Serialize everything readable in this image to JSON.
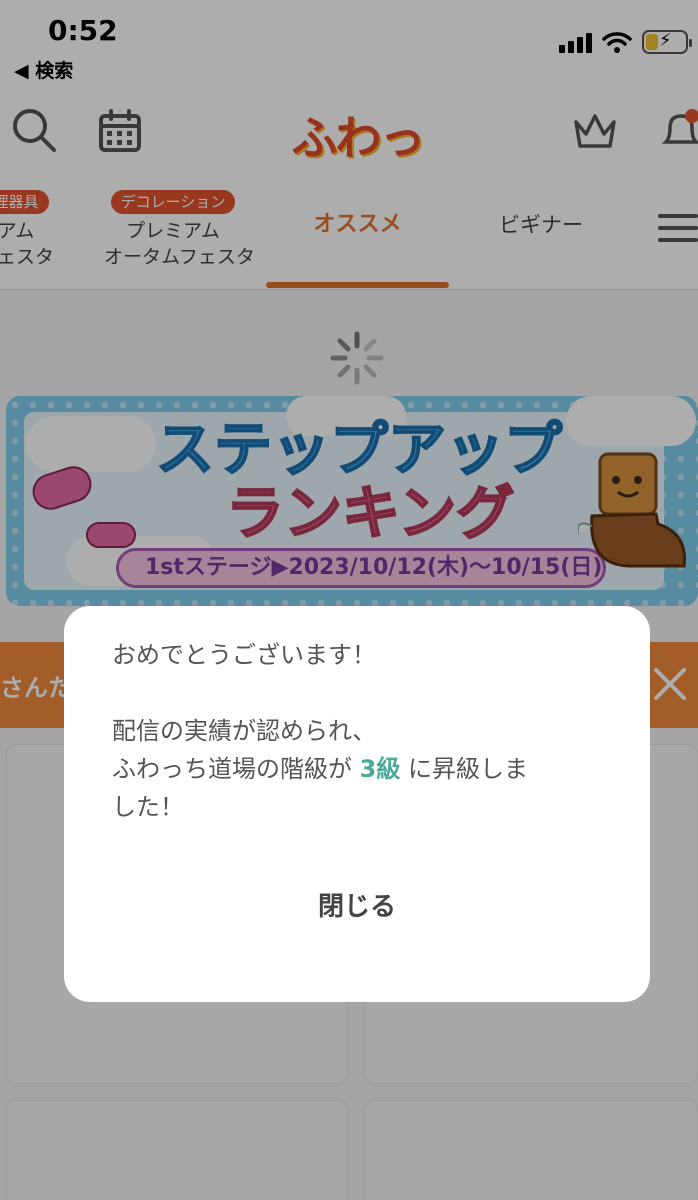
{
  "status_bar": {
    "time": "0:52",
    "back_label": "◀ 検索"
  },
  "header": {
    "logo": "ふわっち",
    "icons": {
      "search": "search-icon",
      "calendar": "calendar-icon",
      "ranking": "crown-icon",
      "notifications": "bell-icon"
    }
  },
  "tabs": [
    {
      "badge": "理器具",
      "label_line1": "アム",
      "label_line2": "フェスタ"
    },
    {
      "badge": "デコレーション",
      "label_line1": "プレミアム",
      "label_line2": "オータムフェスタ"
    },
    {
      "label": "オススメ",
      "active": true
    },
    {
      "label": "ビギナー"
    }
  ],
  "banner": {
    "title_line1": "ステップアップ",
    "title_line2": "ランキング",
    "date": "1stステージ▶2023/10/12(木)〜10/15(日)"
  },
  "notice_strip": {
    "text": "さんた"
  },
  "modal": {
    "line1": "おめでとうございます！",
    "line2": "配信の実績が認められ、",
    "line3_pre": "ふわっち道場の階級が ",
    "line3_rank": "3級",
    "line3_post": " に昇級しま",
    "line4": "した！",
    "close_label": "閉じる"
  },
  "colors": {
    "accent": "#e0742e",
    "badge": "#e0542e",
    "highlight": "#4aa99a",
    "overlay": "rgba(0,0,0,0.32)"
  }
}
